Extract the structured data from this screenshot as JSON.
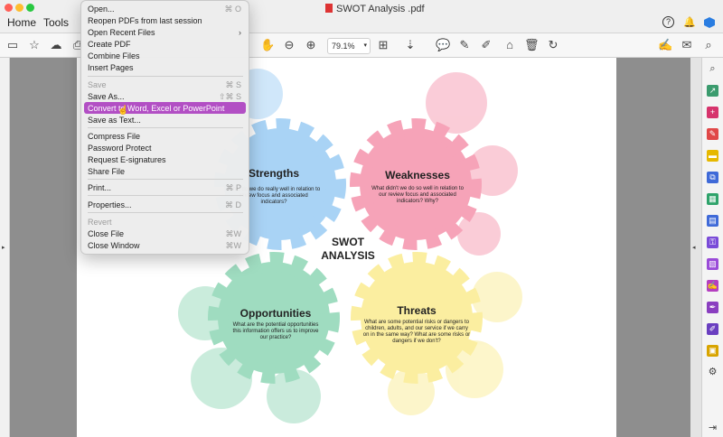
{
  "app": {
    "menu_tabs": [
      "Home",
      "Tools"
    ],
    "doc_title": "SWOT Analysis .pdf",
    "zoom": "79.1%"
  },
  "file_menu": {
    "items": [
      {
        "label": "Open...",
        "shortcut": "⌘ O",
        "enabled": true
      },
      {
        "label": "Reopen PDFs from last session",
        "shortcut": "",
        "enabled": true
      },
      {
        "label": "Open Recent Files",
        "shortcut": "",
        "submenu": true,
        "enabled": true
      },
      {
        "label": "Create PDF",
        "shortcut": "",
        "enabled": true
      },
      {
        "label": "Combine Files",
        "shortcut": "",
        "enabled": true
      },
      {
        "label": "Insert Pages",
        "shortcut": "",
        "enabled": true
      },
      {
        "label": "Save",
        "shortcut": "⌘ S",
        "enabled": false
      },
      {
        "label": "Save As...",
        "shortcut": "⇧⌘ S",
        "enabled": true
      },
      {
        "label": "Convert to Word, Excel or PowerPoint",
        "shortcut": "",
        "enabled": true,
        "highlighted": true
      },
      {
        "label": "Save as Text...",
        "shortcut": "",
        "enabled": true
      },
      {
        "label": "Compress File",
        "shortcut": "",
        "enabled": true
      },
      {
        "label": "Password Protect",
        "shortcut": "",
        "enabled": true
      },
      {
        "label": "Request E-signatures",
        "shortcut": "",
        "enabled": true
      },
      {
        "label": "Share File",
        "shortcut": "",
        "enabled": true
      },
      {
        "label": "Print...",
        "shortcut": "⌘ P",
        "enabled": true
      },
      {
        "label": "Properties...",
        "shortcut": "⌘ D",
        "enabled": true
      },
      {
        "label": "Revert",
        "shortcut": "",
        "enabled": false
      },
      {
        "label": "Close File",
        "shortcut": "⌘W",
        "enabled": true
      },
      {
        "label": "Close Window",
        "shortcut": "⌘W",
        "enabled": true
      }
    ]
  },
  "swot": {
    "center_line1": "SWOT",
    "center_line2": "ANALYSIS",
    "strengths": {
      "title": "Strengths",
      "desc1": "What do we do really well in relation to",
      "desc2": "review focus and associated",
      "desc3": "indicators?"
    },
    "weaknesses": {
      "title": "Weaknesses",
      "desc1": "What didn't we do so well in relation to",
      "desc2": "our review focus and associated",
      "desc3": "indicators? Why?"
    },
    "opportunities": {
      "title": "Opportunities",
      "desc1": "What are the potential opportunities",
      "desc2": "this information offers us to improve",
      "desc3": "our practice?"
    },
    "threats": {
      "title": "Threats",
      "desc1": "What are some potential risks or dangers to",
      "desc2": "children, adults, and our service if we carry",
      "desc3": "on in the same way? What are some risks or",
      "desc4": "dangers if we don't?"
    }
  },
  "colors": {
    "strengths": "#a9d3f5",
    "weaknesses": "#f6a3b8",
    "opportunities": "#9fdcc0",
    "threats": "#fbeea0",
    "menu_highlight": "#b24fc4"
  }
}
